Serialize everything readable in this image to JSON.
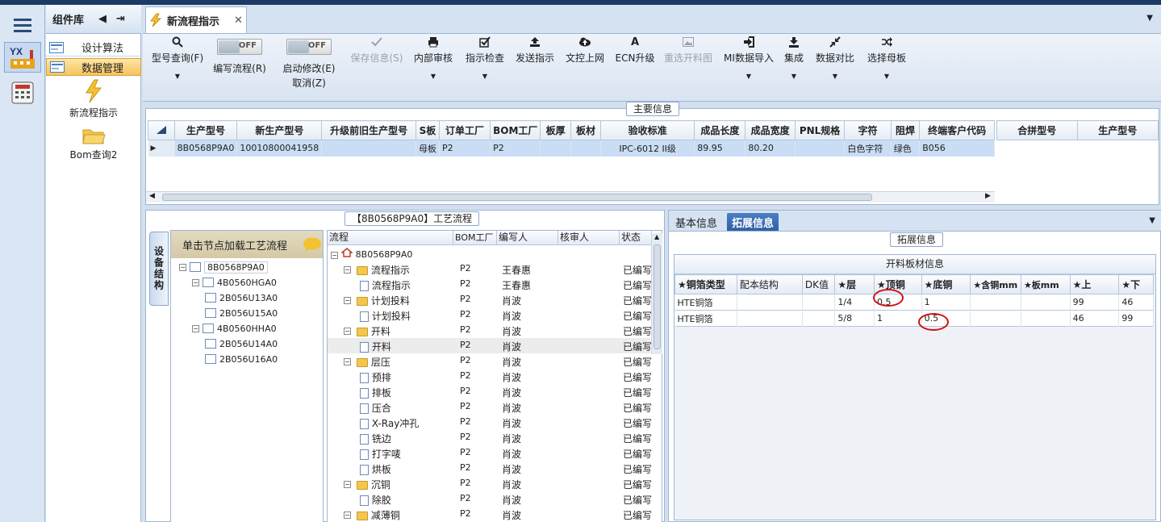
{
  "window": {
    "title": "新流程指示"
  },
  "left_rail": {
    "items": [
      {
        "icon": "menu-icon"
      },
      {
        "icon": "yx-factory-icon"
      },
      {
        "icon": "calculator-icon"
      }
    ]
  },
  "component_panel": {
    "title": "组件库",
    "items": [
      {
        "label": "设计算法"
      },
      {
        "label": "数据管理"
      }
    ],
    "tiles": [
      {
        "label": "新流程指示"
      },
      {
        "label": "Bom查询2"
      }
    ]
  },
  "toolbar": {
    "buttons": [
      {
        "label": "型号查询(F)",
        "icon": "search-icon"
      },
      {
        "label": "编写流程(R)",
        "toggle": "OFF"
      },
      {
        "label": "启动修改(E)",
        "sublabel": "取消(Z)",
        "toggle": "OFF"
      },
      {
        "label": "保存信息(S)",
        "icon": "check-icon",
        "disabled": true
      },
      {
        "label": "内部审核",
        "icon": "print-icon"
      },
      {
        "label": "指示检查",
        "icon": "checkbox-icon"
      },
      {
        "label": "发送指示",
        "icon": "upload-icon"
      },
      {
        "label": "文控上网",
        "icon": "cloud-upload-icon"
      },
      {
        "label": "ECN升级",
        "icon": "font-icon"
      },
      {
        "label": "重选开料图",
        "icon": "picture-icon",
        "disabled": true
      },
      {
        "label": "MI数据导入",
        "icon": "sign-in-icon"
      },
      {
        "label": "集成",
        "icon": "download-icon"
      },
      {
        "label": "数据对比",
        "icon": "compress-icon"
      },
      {
        "label": "选择母板",
        "icon": "shuffle-icon"
      }
    ]
  },
  "main_info": {
    "label": "主要信息",
    "columns": [
      "生产型号",
      "新生产型号",
      "升级前旧生产型号",
      "S板",
      "订单工厂",
      "BOM工厂",
      "板厚",
      "板材",
      "验收标准",
      "成品长度",
      "成品宽度",
      "PNL规格",
      "字符",
      "阻焊",
      "终端客户代码"
    ],
    "row": [
      "8B0568P9A0",
      "10010800041958",
      "",
      "母板",
      "P2",
      "P2",
      "",
      "",
      "IPC-6012 II级",
      "89.95",
      "80.20",
      "",
      "白色字符",
      "绿色",
      "B056"
    ],
    "side_columns": [
      "合拼型号",
      "生产型号"
    ]
  },
  "process": {
    "label": "【8B0568P9A0】工艺流程",
    "vertical_tab": "设备结构",
    "tree_hint": "单击节点加载工艺流程",
    "tree": [
      {
        "label": "8B0568P9A0",
        "level": 0
      },
      {
        "label": "4B0560HGA0",
        "level": 1
      },
      {
        "label": "2B056U13A0",
        "level": 2
      },
      {
        "label": "2B056U15A0",
        "level": 2
      },
      {
        "label": "4B0560HHA0",
        "level": 1
      },
      {
        "label": "2B056U14A0",
        "level": 2
      },
      {
        "label": "2B056U16A0",
        "level": 2
      }
    ],
    "flow_columns": [
      "流程",
      "BOM工厂",
      "编写人",
      "核审人",
      "状态"
    ],
    "flow_root": "8B0568P9A0",
    "flow_rows": [
      {
        "name": "流程指示",
        "type": "folder",
        "bom": "P2",
        "writer": "王春惠",
        "status": "已编写"
      },
      {
        "name": "流程指示",
        "type": "doc",
        "bom": "P2",
        "writer": "王春惠",
        "status": "已编写"
      },
      {
        "name": "计划投料",
        "type": "folder",
        "bom": "P2",
        "writer": "肖波",
        "status": "已编写"
      },
      {
        "name": "计划投料",
        "type": "doc",
        "bom": "P2",
        "writer": "肖波",
        "status": "已编写"
      },
      {
        "name": "开料",
        "type": "folder",
        "bom": "P2",
        "writer": "肖波",
        "status": "已编写"
      },
      {
        "name": "开料",
        "type": "doc",
        "bom": "P2",
        "writer": "肖波",
        "status": "已编写",
        "selected": true
      },
      {
        "name": "层压",
        "type": "folder",
        "bom": "P2",
        "writer": "肖波",
        "status": "已编写"
      },
      {
        "name": "预排",
        "type": "doc",
        "bom": "P2",
        "writer": "肖波",
        "status": "已编写"
      },
      {
        "name": "排板",
        "type": "doc",
        "bom": "P2",
        "writer": "肖波",
        "status": "已编写"
      },
      {
        "name": "压合",
        "type": "doc",
        "bom": "P2",
        "writer": "肖波",
        "status": "已编写"
      },
      {
        "name": "X-Ray冲孔",
        "type": "doc",
        "bom": "P2",
        "writer": "肖波",
        "status": "已编写"
      },
      {
        "name": "铣边",
        "type": "doc",
        "bom": "P2",
        "writer": "肖波",
        "status": "已编写"
      },
      {
        "name": "打字唛",
        "type": "doc",
        "bom": "P2",
        "writer": "肖波",
        "status": "已编写"
      },
      {
        "name": "烘板",
        "type": "doc",
        "bom": "P2",
        "writer": "肖波",
        "status": "已编写"
      },
      {
        "name": "沉铜",
        "type": "folder",
        "bom": "P2",
        "writer": "肖波",
        "status": "已编写"
      },
      {
        "name": "除胶",
        "type": "doc",
        "bom": "P2",
        "writer": "肖波",
        "status": "已编写"
      },
      {
        "name": "减薄铜",
        "type": "folder",
        "bom": "P2",
        "writer": "肖波",
        "status": "已编写"
      }
    ]
  },
  "extension": {
    "tabs": [
      "基本信息",
      "拓展信息"
    ],
    "label": "拓展信息",
    "table_title": "开料板材信息",
    "columns": [
      "★铜箔类型",
      "配本结构",
      "DK值",
      "★层",
      "★顶铜",
      "★底铜",
      "★含铜mm",
      "★板mm",
      "★上",
      "★下"
    ],
    "rows": [
      [
        "HTE铜箔",
        "",
        "",
        "1/4",
        "0.5",
        "1",
        "",
        "",
        "99",
        "46"
      ],
      [
        "HTE铜箔",
        "",
        "",
        "5/8",
        "1",
        "0.5",
        "",
        "",
        "46",
        "99"
      ]
    ]
  }
}
